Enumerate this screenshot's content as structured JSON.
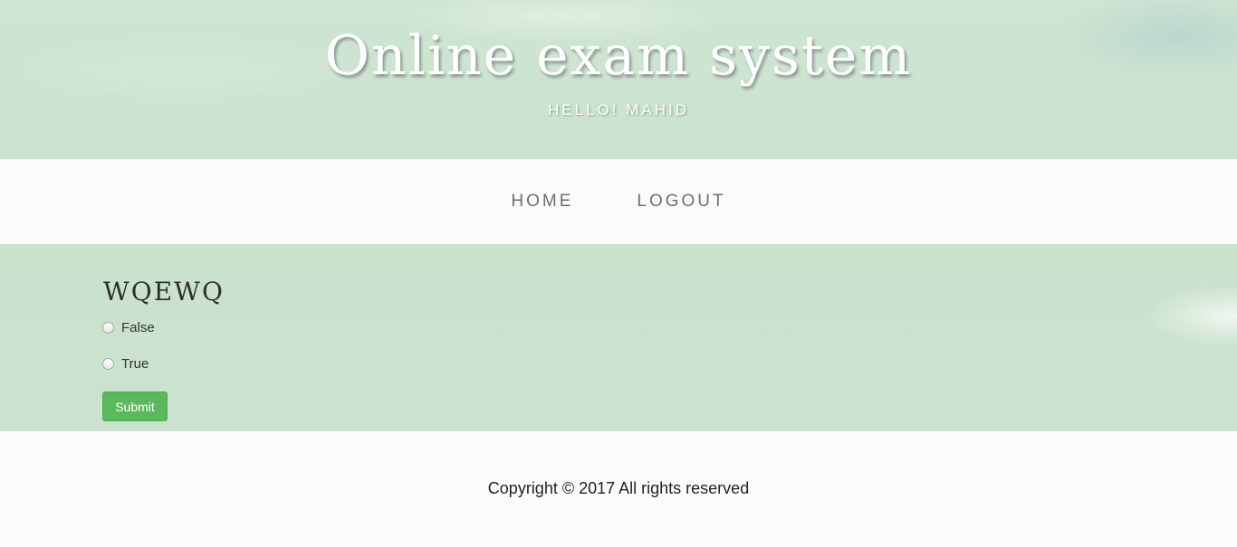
{
  "header": {
    "title": "Online exam system",
    "greeting": "HELLO! MAHID"
  },
  "nav": {
    "items": [
      {
        "label": "HOME"
      },
      {
        "label": "LOGOUT"
      }
    ]
  },
  "question": {
    "title": "WQEWQ",
    "options": [
      {
        "label": "False",
        "selected": false
      },
      {
        "label": "True",
        "selected": false
      }
    ],
    "submit_label": "Submit"
  },
  "footer": {
    "copyright": "Copyright © 2017 All rights reserved"
  },
  "colors": {
    "submit_button": "#5cb85c",
    "background": "#cfe5d3",
    "nav_text": "#6d6d6d"
  }
}
